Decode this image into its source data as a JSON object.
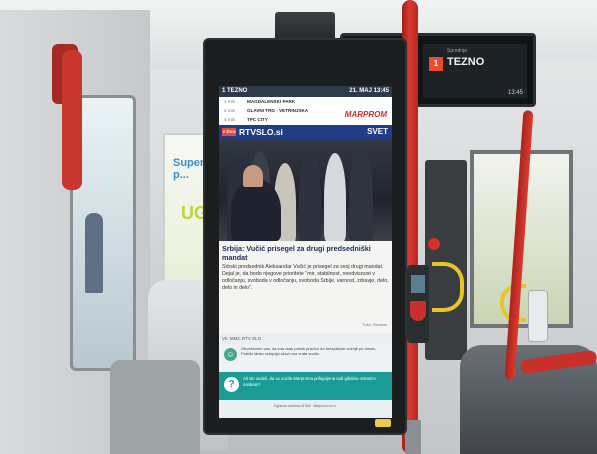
{
  "route_display": {
    "line": "1",
    "destination": "TEZNO",
    "sub": "Sprednje",
    "time": "13:45"
  },
  "screen": {
    "header_left": "1 TEZNO",
    "header_right": "21. MAJ 13:45",
    "stops": [
      {
        "min": "1 min",
        "name": "MAGDALENSKI PARK"
      },
      {
        "min": "2 min",
        "name": "GLAVNI TRG - VETRINJSKA"
      },
      {
        "min": "4 min",
        "name": "TPC CITY"
      }
    ],
    "sponsor": "MARPROM",
    "badge": "V ŽIVO",
    "brand": "RTVSLO.si",
    "section": "SVET",
    "headline": "Srbija: Vučić prisegel za drugi predsedniški mandat",
    "body": "Srbski predsednik Aleksandar Vučić je prisegel za svoj drugi mandat. Dejal je, da bodo njegove prioritete \"mir, stabilnost, neodvisnost v odločanju, svoboda v odločanju, svoboda Srbije, varnost, zdravje, delo, delo in delo\".",
    "credit": "Foto: Reuters",
    "via": "Vir: MMC RTV SLO",
    "notice1": "Obveščamo vas, da ima vsak potnik pravico do brezplačne vožnje po mestu. Potniki lahko vstopajo skozi vsa vrata vozila.",
    "notice2": "Ali ste vedeli, da so vozila Marproma prilagojena tudi gibalno oviranim osebam?",
    "footer": "Oglasna vsebina ATOM · Marprom d.o.o."
  },
  "ad_panel": {
    "text1": "Super p...",
    "text2": "UG"
  }
}
